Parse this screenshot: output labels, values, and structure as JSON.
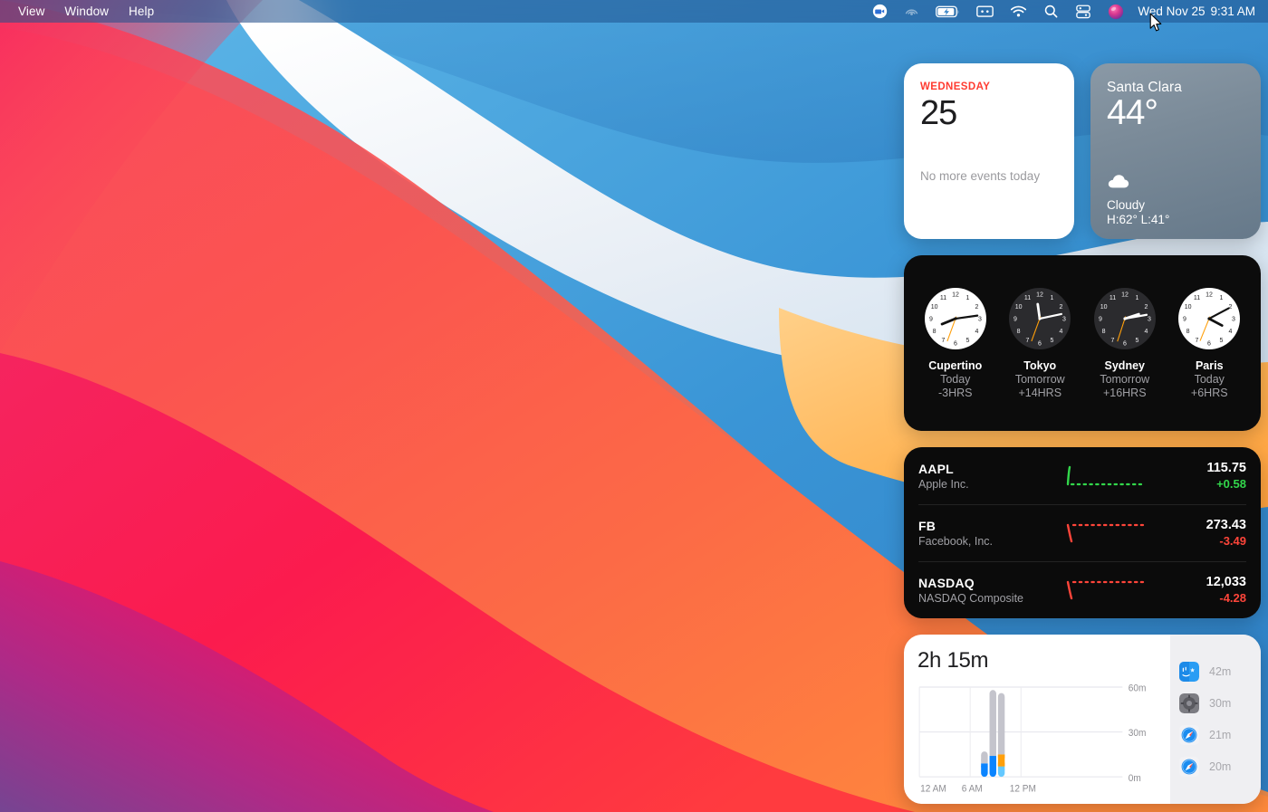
{
  "menubar": {
    "menus": [
      {
        "label": "View"
      },
      {
        "label": "Window"
      },
      {
        "label": "Help"
      }
    ],
    "status_icons": [
      {
        "name": "zoom-meeting-icon",
        "label": "Zoom"
      },
      {
        "name": "airplay-icon",
        "label": "AirPlay"
      },
      {
        "name": "battery-charging-icon",
        "label": "Battery charging"
      },
      {
        "name": "screenshot-icon",
        "label": "Screenshot"
      },
      {
        "name": "wifi-icon",
        "label": "Wi-Fi"
      },
      {
        "name": "spotlight-search-icon",
        "label": "Spotlight Search"
      },
      {
        "name": "control-center-icon",
        "label": "Control Center"
      },
      {
        "name": "siri-icon",
        "label": "Siri"
      }
    ],
    "date": "Wed Nov 25",
    "time": "9:31 AM"
  },
  "calendar": {
    "weekday": "WEDNESDAY",
    "day": "25",
    "events_text": "No more events today",
    "accent": "#ff3b30"
  },
  "weather": {
    "city": "Santa Clara",
    "temperature": "44°",
    "condition": "Cloudy",
    "high_low": "H:62° L:41°",
    "icon": "cloud-icon"
  },
  "world_clock": {
    "clocks": [
      {
        "city": "Cupertino",
        "day": "Today",
        "offset": "-3HRS",
        "face": "light",
        "hour_deg": 248,
        "minute_deg": 82,
        "second_deg": 200
      },
      {
        "city": "Tokyo",
        "day": "Tomorrow",
        "offset": "+14HRS",
        "face": "dark",
        "hour_deg": 352,
        "minute_deg": 78,
        "second_deg": 200
      },
      {
        "city": "Sydney",
        "day": "Tomorrow",
        "offset": "+16HRS",
        "face": "dark",
        "hour_deg": 72,
        "minute_deg": 80,
        "second_deg": 198
      },
      {
        "city": "Paris",
        "day": "Today",
        "offset": "+6HRS",
        "face": "light",
        "hour_deg": 118,
        "minute_deg": 62,
        "second_deg": 202
      }
    ]
  },
  "stocks": {
    "rows": [
      {
        "symbol": "AAPL",
        "name": "Apple Inc.",
        "price": "115.75",
        "change": "+0.58",
        "direction": "up",
        "color": "#32d74b"
      },
      {
        "symbol": "FB",
        "name": "Facebook, Inc.",
        "price": "273.43",
        "change": "-3.49",
        "direction": "down",
        "color": "#ff453a"
      },
      {
        "symbol": "NASDAQ",
        "name": "NASDAQ Composite",
        "price": "12,033",
        "change": "-4.28",
        "direction": "down",
        "color": "#ff453a"
      }
    ]
  },
  "screen_time": {
    "total": "2h 15m",
    "apps": [
      {
        "name": "Finder",
        "time": "42m",
        "icon": "finder-icon"
      },
      {
        "name": "Settings",
        "time": "30m",
        "icon": "settings-gear-icon"
      },
      {
        "name": "Safari",
        "time": "21m",
        "icon": "safari-icon"
      },
      {
        "name": "Safari",
        "time": "20m",
        "icon": "safari-icon"
      }
    ],
    "chart_data": {
      "type": "bar",
      "title": "2h 15m",
      "xlabel": "",
      "ylabel": "",
      "ylim": [
        0,
        60
      ],
      "yticks": [
        "0m",
        "30m",
        "60m"
      ],
      "ytick_values": [
        0,
        30,
        60
      ],
      "xticks": [
        "12 AM",
        "6 AM",
        "12 PM"
      ],
      "xtick_hours": [
        0,
        6,
        12
      ],
      "grid": true,
      "x_hours": [
        7,
        8,
        9
      ],
      "bars": [
        {
          "hour": 7,
          "total": 17,
          "segments": [
            {
              "color": "#0a84ff",
              "value": 9
            },
            {
              "color": "#c4c4cc",
              "value": 8
            }
          ]
        },
        {
          "hour": 8,
          "total": 58,
          "segments": [
            {
              "color": "#0a84ff",
              "value": 14
            },
            {
              "color": "#c4c4cc",
              "value": 44
            }
          ]
        },
        {
          "hour": 9,
          "total": 56,
          "segments": [
            {
              "color": "#64c8ff",
              "value": 7
            },
            {
              "color": "#ff9f0a",
              "value": 8
            },
            {
              "color": "#c4c4cc",
              "value": 41
            }
          ]
        }
      ]
    }
  }
}
